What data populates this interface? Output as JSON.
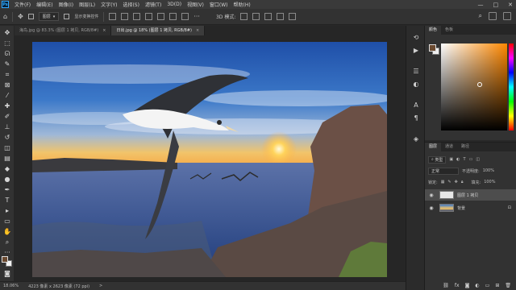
{
  "app": {
    "logo_text": "Ps"
  },
  "menu": {
    "items": [
      "文件(F)",
      "编辑(E)",
      "图像(I)",
      "图层(L)",
      "文字(Y)",
      "选择(S)",
      "滤镜(T)",
      "3D(D)",
      "视图(V)",
      "窗口(W)",
      "帮助(H)"
    ]
  },
  "window_controls": {
    "minimize": "—",
    "maximize": "□",
    "close": "✕"
  },
  "options_bar": {
    "layer_dropdown": "图层",
    "transform_label": "显示变换控件"
  },
  "tabs": [
    {
      "label": "海鸟.jpg @ 83.3% (图层 1 拷贝, RGB/8#)",
      "close": "×",
      "active": false
    },
    {
      "label": "日出.jpg @ 18% (图层 1 拷贝, RGB/8#)",
      "close": "×",
      "active": true
    }
  ],
  "status": {
    "zoom": "18.06%",
    "doc_size": "4223 像素 x 2623 像素 (72 ppi)",
    "arrow": ">"
  },
  "color_panel": {
    "tabs": [
      "颜色",
      "色板"
    ],
    "fg_color": "#6b4a30",
    "bg_color": "#efefef"
  },
  "layers_panel": {
    "tabs": [
      "图层",
      "通道",
      "路径"
    ],
    "kind_filter": "类型",
    "blend_mode": "正常",
    "opacity_label": "不透明度:",
    "opacity_value": "100%",
    "lock_label": "锁定:",
    "fill_label": "填充:",
    "fill_value": "100%",
    "layers": [
      {
        "name": "图层 1 拷贝",
        "selected": true
      },
      {
        "name": "背景",
        "selected": false
      }
    ]
  },
  "icons": {
    "home": "⌂",
    "move": "✥",
    "close_tab": "×",
    "tools": [
      "move-icon",
      "marquee-icon",
      "lasso-icon",
      "quick-select-icon",
      "crop-icon",
      "frame-icon",
      "eyedropper-icon",
      "healing-icon",
      "brush-icon",
      "stamp-icon",
      "history-brush-icon",
      "eraser-icon",
      "gradient-icon",
      "blur-icon",
      "dodge-icon",
      "pen-icon",
      "type-icon",
      "path-select-icon",
      "rectangle-icon",
      "hand-icon",
      "zoom-icon",
      "more-icon"
    ],
    "dock": [
      "history-icon",
      "actions-icon",
      "properties-icon",
      "adjust-icon",
      "character-icon",
      "paragraph-icon",
      "library-icon"
    ]
  }
}
